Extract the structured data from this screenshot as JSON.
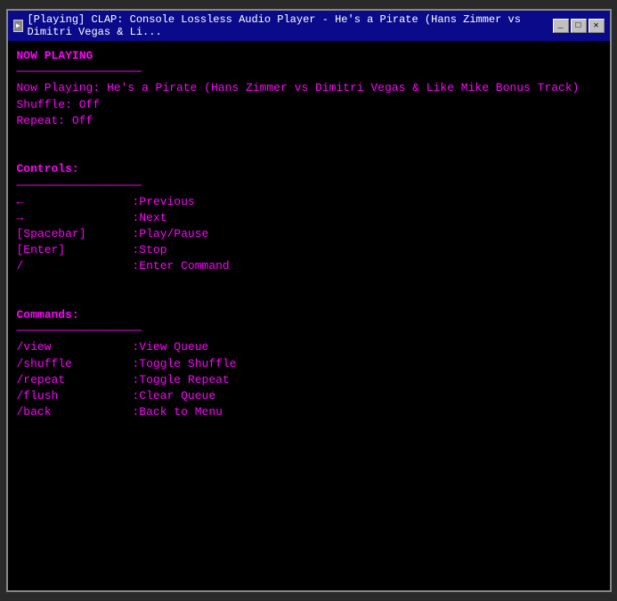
{
  "window": {
    "title": "[Playing] CLAP: Console Lossless Audio Player - He's a Pirate (Hans Zimmer vs Dimitri Vegas & Li...",
    "icon": "►"
  },
  "titlebar": {
    "minimize_label": "_",
    "maximize_label": "□",
    "close_label": "✕"
  },
  "terminal": {
    "heading": "NOW PLAYING",
    "divider1": "──────────────────",
    "now_playing_label": "Now Playing:",
    "now_playing_value": "He's a Pirate (Hans Zimmer vs Dimitri Vegas & Like Mike Bonus Track)",
    "shuffle": "Shuffle: Off",
    "repeat": "Repeat: Off",
    "controls_heading": "Controls:",
    "divider2": "──────────────────",
    "controls": [
      {
        "key": "←",
        "action": ":Previous"
      },
      {
        "key": "→",
        "action": ":Next"
      },
      {
        "key": "[Spacebar]",
        "action": ":Play/Pause"
      },
      {
        "key": "[Enter]",
        "action": ":Stop"
      },
      {
        "key": "/",
        "action": ":Enter Command"
      }
    ],
    "commands_heading": "Commands:",
    "divider3": "──────────────────",
    "commands": [
      {
        "key": "/view",
        "action": ":View Queue"
      },
      {
        "key": "/shuffle",
        "action": ":Toggle Shuffle"
      },
      {
        "key": "/repeat",
        "action": ":Toggle Repeat"
      },
      {
        "key": "/flush",
        "action": ":Clear Queue"
      },
      {
        "key": "/back",
        "action": ":Back to Menu"
      }
    ]
  }
}
